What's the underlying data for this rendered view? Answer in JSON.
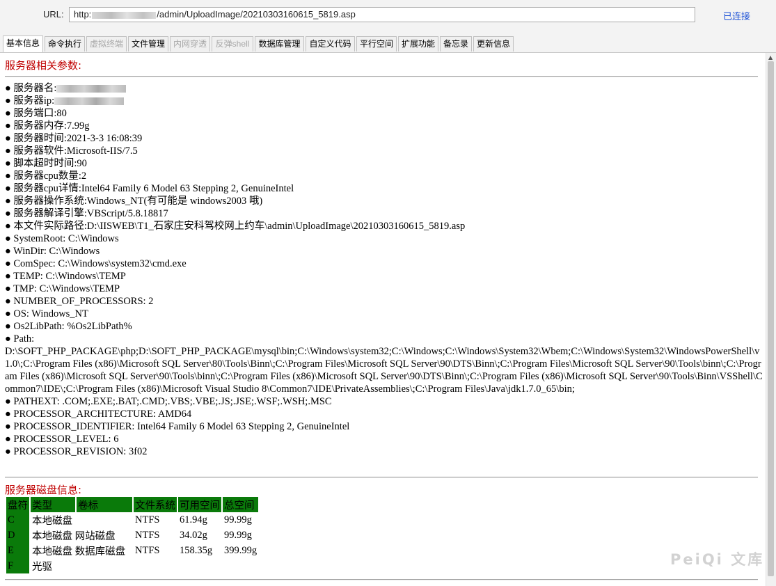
{
  "url_bar": {
    "label": "URL:",
    "url_prefix": "http:",
    "url_suffix": "/admin/UploadImage/20210303160615_5819.asp",
    "status": "已连接"
  },
  "tabs": [
    {
      "label": "基本信息",
      "state": "active"
    },
    {
      "label": "命令执行",
      "state": "normal"
    },
    {
      "label": "虚拟终端",
      "state": "disabled"
    },
    {
      "label": "文件管理",
      "state": "normal"
    },
    {
      "label": "内网穿透",
      "state": "disabled"
    },
    {
      "label": "反弹shell",
      "state": "disabled"
    },
    {
      "label": "数据库管理",
      "state": "normal"
    },
    {
      "label": "自定义代码",
      "state": "normal"
    },
    {
      "label": "平行空间",
      "state": "normal"
    },
    {
      "label": "扩展功能",
      "state": "normal"
    },
    {
      "label": "备忘录",
      "state": "normal"
    },
    {
      "label": "更新信息",
      "state": "normal"
    }
  ],
  "server_section": {
    "title": "服务器相关参数:",
    "items": [
      "● 服务器名:",
      "● 服务器ip:",
      "● 服务端口:80",
      "● 服务器内存:7.99g",
      "● 服务器时间:2021-3-3 16:08:39",
      "● 服务器软件:Microsoft-IIS/7.5",
      "● 脚本超时时间:90",
      "● 服务器cpu数量:2",
      "● 服务器cpu详情:Intel64 Family 6 Model 63 Stepping 2, GenuineIntel",
      "● 服务器操作系统:Windows_NT(有可能是 windows2003 哦)",
      "● 服务器解译引擎:VBScript/5.8.18817",
      "● 本文件实际路径:D:\\IISWEB\\T1_石家庄安科驾校网上约车\\admin\\UploadImage\\20210303160615_5819.asp",
      "● SystemRoot: C:\\Windows",
      "● WinDir: C:\\Windows",
      "● ComSpec: C:\\Windows\\system32\\cmd.exe",
      "● TEMP: C:\\Windows\\TEMP",
      "● TMP: C:\\Windows\\TEMP",
      "● NUMBER_OF_PROCESSORS: 2",
      "● OS: Windows_NT",
      "● Os2LibPath: %Os2LibPath%",
      "● Path:",
      "D:\\SOFT_PHP_PACKAGE\\php;D:\\SOFT_PHP_PACKAGE\\mysql\\bin;C:\\Windows\\system32;C:\\Windows;C:\\Windows\\System32\\Wbem;C:\\Windows\\System32\\WindowsPowerShell\\v1.0\\;C:\\Program Files (x86)\\Microsoft SQL Server\\80\\Tools\\Binn\\;C:\\Program Files\\Microsoft SQL Server\\90\\DTS\\Binn\\;C:\\Program Files\\Microsoft SQL Server\\90\\Tools\\binn\\;C:\\Program Files (x86)\\Microsoft SQL Server\\90\\Tools\\binn\\;C:\\Program Files (x86)\\Microsoft SQL Server\\90\\DTS\\Binn\\;C:\\Program Files (x86)\\Microsoft SQL Server\\90\\Tools\\Binn\\VSShell\\Common7\\IDE\\;C:\\Program Files (x86)\\Microsoft Visual Studio 8\\Common7\\IDE\\PrivateAssemblies\\;C:\\Program Files\\Java\\jdk1.7.0_65\\bin;",
      "● PATHEXT: .COM;.EXE;.BAT;.CMD;.VBS;.VBE;.JS;.JSE;.WSF;.WSH;.MSC",
      "● PROCESSOR_ARCHITECTURE: AMD64",
      "● PROCESSOR_IDENTIFIER: Intel64 Family 6 Model 63 Stepping 2, GenuineIntel",
      "● PROCESSOR_LEVEL: 6",
      "● PROCESSOR_REVISION: 3f02"
    ]
  },
  "disk_section": {
    "title": "服务器磁盘信息:",
    "headers": [
      "盘符",
      "类型",
      "卷标",
      "文件系统",
      "可用空间",
      "总空间"
    ],
    "rows": [
      [
        "C",
        "本地磁盘",
        "",
        "NTFS",
        "61.94g",
        "99.99g"
      ],
      [
        "D",
        "本地磁盘",
        "网站磁盘",
        "NTFS",
        "34.02g",
        "99.99g"
      ],
      [
        "E",
        "本地磁盘",
        "数据库磁盘",
        "NTFS",
        "158.35g",
        "399.99g"
      ],
      [
        "F",
        "光驱",
        "",
        "",
        "",
        ""
      ]
    ]
  },
  "watermark": "PeiQi 文库",
  "colors": {
    "section_title": "#c00000",
    "table_header": "#0a7a0a",
    "link": "#1a4fd6"
  }
}
